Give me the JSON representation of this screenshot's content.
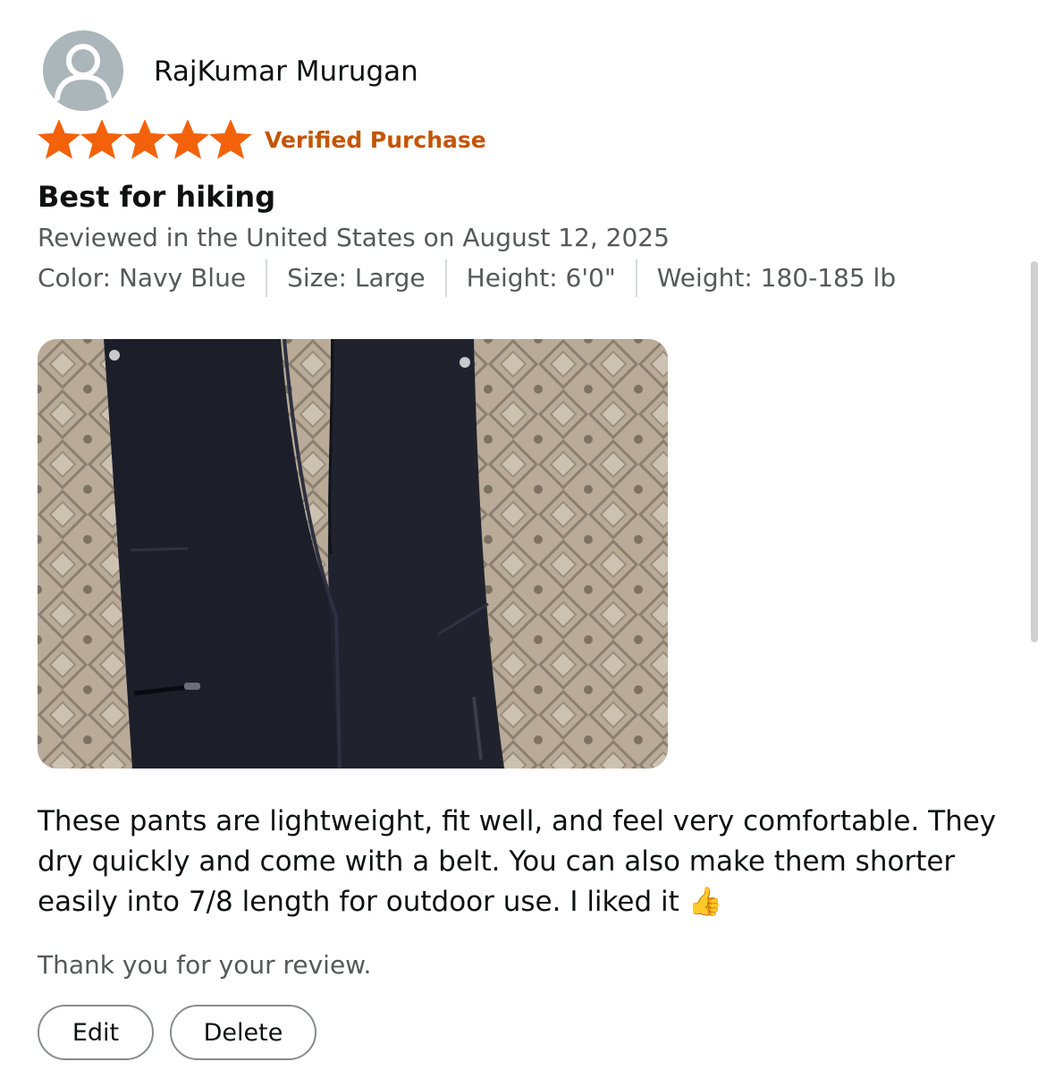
{
  "review": {
    "reviewer_name": "RajKumar Murugan",
    "rating": 5,
    "rating_max": 5,
    "verified_label": "Verified Purchase",
    "title": "Best for hiking",
    "meta": "Reviewed in the United States on August 12, 2025",
    "attributes": [
      "Color: Navy Blue",
      "Size: Large",
      "Height: 6'0\"",
      "Weight: 180-185 lb"
    ],
    "body": "These pants are lightweight, fit well, and feel very comfortable. They dry quickly and come with a belt. You can also make them shorter easily into 7/8 length for outdoor use. I liked it 👍",
    "thanks": "Thank you for your review."
  },
  "actions": {
    "edit_label": "Edit",
    "delete_label": "Delete"
  },
  "colors": {
    "star": "#f3620b",
    "verified": "#c45500",
    "avatar_bg": "#aab6ba",
    "muted_text": "#565959",
    "pants": "#1c1f2a",
    "carpet": "#b7a996"
  },
  "icons": {
    "avatar": "person-silhouette-icon",
    "star": "star-icon",
    "photo_subject": "navy-hiking-pants-photo"
  }
}
